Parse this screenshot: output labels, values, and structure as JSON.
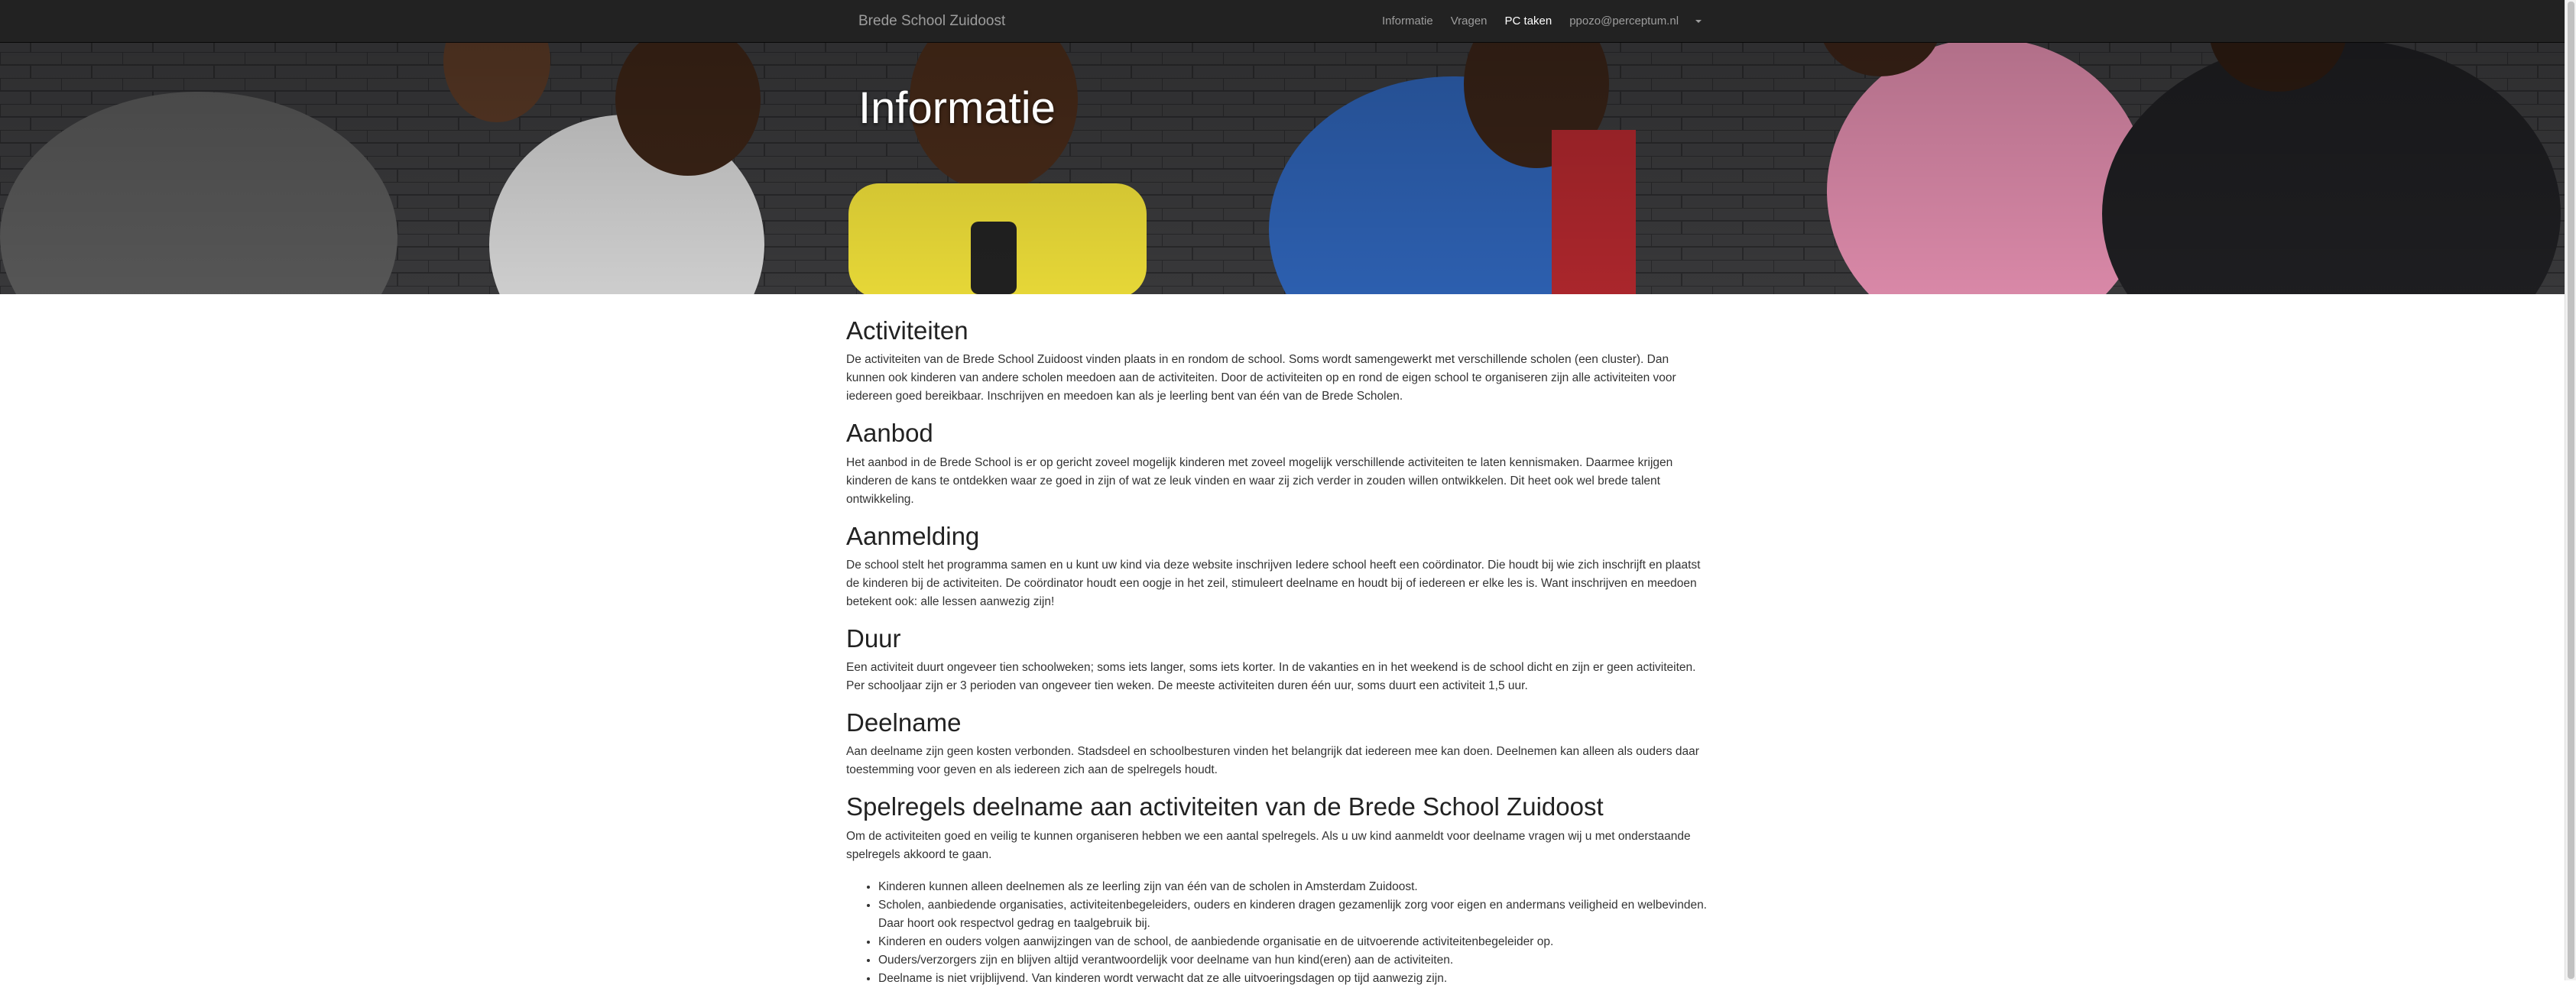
{
  "navbar": {
    "brand": "Brede School Zuidoost",
    "items": [
      {
        "label": "Informatie",
        "active": false
      },
      {
        "label": "Vragen",
        "active": false
      },
      {
        "label": "PC taken",
        "active": true
      },
      {
        "label": "ppozo@perceptum.nl",
        "active": false
      }
    ]
  },
  "hero": {
    "title": "Informatie"
  },
  "sections": [
    {
      "heading": "Activiteiten",
      "text": "De activiteiten van de Brede School Zuidoost vinden plaats in en rondom de school. Soms wordt samengewerkt met verschillende scholen (een cluster). Dan kunnen ook kinderen van andere scholen meedoen aan de activiteiten. Door de activiteiten op en rond de eigen school te organiseren zijn alle activiteiten voor iedereen goed bereikbaar. Inschrijven en meedoen kan als je leerling bent van één van de Brede Scholen."
    },
    {
      "heading": "Aanbod",
      "text": "Het aanbod in de Brede School is er op gericht zoveel mogelijk kinderen met zoveel mogelijk verschillende activiteiten te laten kennismaken. Daarmee krijgen kinderen de kans te ontdekken waar ze goed in zijn of wat ze leuk vinden en waar zij zich verder in zouden willen ontwikkelen. Dit heet ook wel brede talent ontwikkeling."
    },
    {
      "heading": "Aanmelding",
      "text": "De school stelt het programma samen en u kunt uw kind via deze website inschrijven Iedere school heeft een coördinator. Die houdt bij wie zich inschrijft en plaatst de kinderen bij de activiteiten. De coördinator houdt een oogje in het zeil, stimuleert deelname en houdt bij of iedereen er elke les is. Want inschrijven en meedoen betekent ook: alle lessen aanwezig zijn!"
    },
    {
      "heading": "Duur",
      "text": "Een activiteit duurt ongeveer tien schoolweken; soms iets langer, soms iets korter. In de vakanties en in het weekend is de school dicht en zijn er geen activiteiten. Per schooljaar zijn er 3 perioden van ongeveer tien weken. De meeste activiteiten duren één uur, soms duurt een activiteit 1,5 uur."
    },
    {
      "heading": "Deelname",
      "text": "Aan deelname zijn geen kosten verbonden. Stadsdeel en schoolbesturen vinden het belangrijk dat iedereen mee kan doen. Deelnemen kan alleen als ouders daar toestemming voor geven en als iedereen zich aan de spelregels houdt."
    },
    {
      "heading": "Spelregels deelname aan activiteiten van de Brede School Zuidoost",
      "text": "Om de activiteiten goed en veilig te kunnen organiseren hebben we een aantal spelregels. Als u uw kind aanmeldt voor deelname vragen wij u met onderstaande spelregels akkoord te gaan."
    }
  ],
  "rules": [
    "Kinderen kunnen alleen deelnemen als ze leerling zijn van één van de scholen in Amsterdam Zuidoost.",
    "Scholen, aanbiedende organisaties, activiteitenbegeleiders, ouders en kinderen dragen gezamenlijk zorg voor eigen en andermans veiligheid en welbevinden. Daar hoort ook respectvol gedrag en taalgebruik bij.",
    "Kinderen en ouders volgen aanwijzingen van de school, de aanbiedende organisatie en de uitvoerende activiteitenbegeleider op.",
    "Ouders/verzorgers zijn en blijven altijd verantwoordelijk voor deelname van hun kind(eren) aan de activiteiten.",
    "Deelname is niet vrijblijvend. Van kinderen wordt verwacht dat ze alle uitvoeringsdagen op tijd aanwezig zijn."
  ],
  "colors": {
    "navbar_bg": "#222222",
    "nav_link": "#9d9d9d",
    "nav_active": "#ffffff"
  },
  "icons": {
    "user_menu": "caret-down-icon"
  }
}
